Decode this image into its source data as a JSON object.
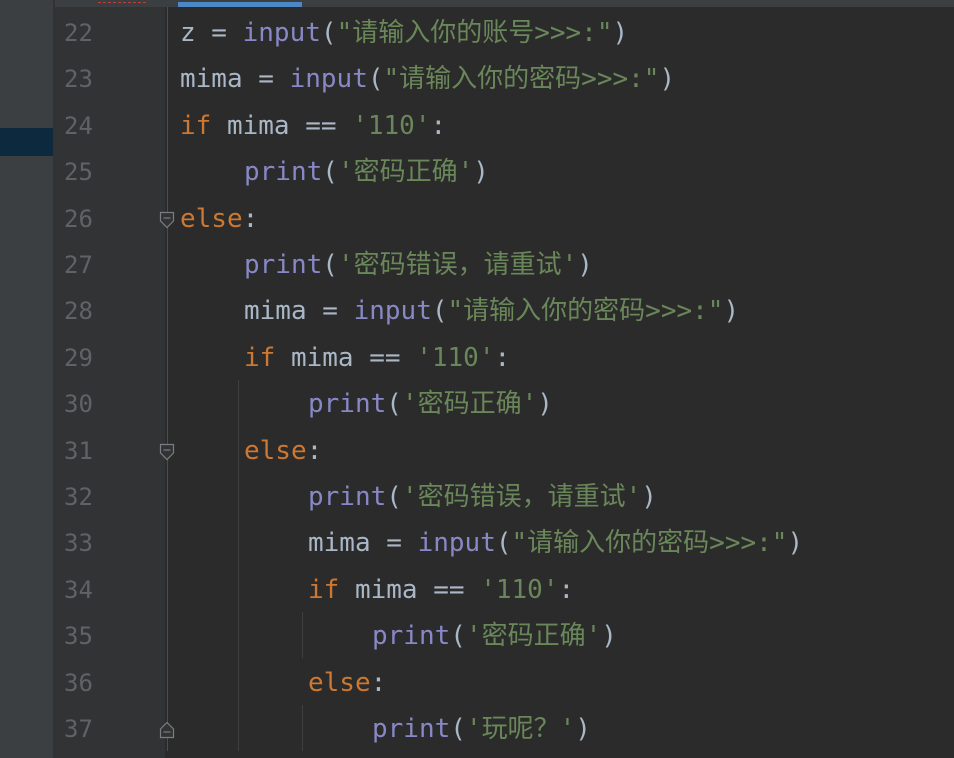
{
  "editor": {
    "lines": [
      {
        "num": "22",
        "indent": 0,
        "fold": "",
        "tokens": [
          {
            "t": "id",
            "v": "z = "
          },
          {
            "t": "fn",
            "v": "input"
          },
          {
            "t": "pn",
            "v": "("
          },
          {
            "t": "str",
            "v": "\"请输入你的账号>>>:\""
          },
          {
            "t": "pn",
            "v": ")"
          }
        ]
      },
      {
        "num": "23",
        "indent": 0,
        "fold": "",
        "tokens": [
          {
            "t": "id",
            "v": "mima = "
          },
          {
            "t": "fn",
            "v": "input"
          },
          {
            "t": "pn",
            "v": "("
          },
          {
            "t": "str",
            "v": "\"请输入你的密码>>>:\""
          },
          {
            "t": "pn",
            "v": ")"
          }
        ]
      },
      {
        "num": "24",
        "indent": 0,
        "fold": "",
        "tokens": [
          {
            "t": "kw",
            "v": "if "
          },
          {
            "t": "id",
            "v": "mima == "
          },
          {
            "t": "str",
            "v": "'110'"
          },
          {
            "t": "pn",
            "v": ":"
          }
        ]
      },
      {
        "num": "25",
        "indent": 1,
        "fold": "",
        "tokens": [
          {
            "t": "fn",
            "v": "print"
          },
          {
            "t": "pn",
            "v": "("
          },
          {
            "t": "str",
            "v": "'密码正确'"
          },
          {
            "t": "pn",
            "v": ")"
          }
        ]
      },
      {
        "num": "26",
        "indent": 0,
        "fold": "open",
        "tokens": [
          {
            "t": "kw",
            "v": "else"
          },
          {
            "t": "pn",
            "v": ":"
          }
        ]
      },
      {
        "num": "27",
        "indent": 1,
        "fold": "",
        "tokens": [
          {
            "t": "fn",
            "v": "print"
          },
          {
            "t": "pn",
            "v": "("
          },
          {
            "t": "str",
            "v": "'密码错误，请重试'"
          },
          {
            "t": "pn",
            "v": ")"
          }
        ]
      },
      {
        "num": "28",
        "indent": 1,
        "fold": "",
        "tokens": [
          {
            "t": "id",
            "v": "mima = "
          },
          {
            "t": "fn",
            "v": "input"
          },
          {
            "t": "pn",
            "v": "("
          },
          {
            "t": "str",
            "v": "\"请输入你的密码>>>:\""
          },
          {
            "t": "pn",
            "v": ")"
          }
        ]
      },
      {
        "num": "29",
        "indent": 1,
        "fold": "",
        "tokens": [
          {
            "t": "kw",
            "v": "if "
          },
          {
            "t": "id",
            "v": "mima == "
          },
          {
            "t": "str",
            "v": "'110'"
          },
          {
            "t": "pn",
            "v": ":"
          }
        ]
      },
      {
        "num": "30",
        "indent": 2,
        "fold": "",
        "tokens": [
          {
            "t": "fn",
            "v": "print"
          },
          {
            "t": "pn",
            "v": "("
          },
          {
            "t": "str",
            "v": "'密码正确'"
          },
          {
            "t": "pn",
            "v": ")"
          }
        ]
      },
      {
        "num": "31",
        "indent": 1,
        "fold": "open",
        "tokens": [
          {
            "t": "kw",
            "v": "else"
          },
          {
            "t": "pn",
            "v": ":"
          }
        ]
      },
      {
        "num": "32",
        "indent": 2,
        "fold": "",
        "tokens": [
          {
            "t": "fn",
            "v": "print"
          },
          {
            "t": "pn",
            "v": "("
          },
          {
            "t": "str",
            "v": "'密码错误，请重试'"
          },
          {
            "t": "pn",
            "v": ")"
          }
        ]
      },
      {
        "num": "33",
        "indent": 2,
        "fold": "",
        "tokens": [
          {
            "t": "id",
            "v": "mima = "
          },
          {
            "t": "fn",
            "v": "input"
          },
          {
            "t": "pn",
            "v": "("
          },
          {
            "t": "str",
            "v": "\"请输入你的密码>>>:\""
          },
          {
            "t": "pn",
            "v": ")"
          }
        ]
      },
      {
        "num": "34",
        "indent": 2,
        "fold": "",
        "tokens": [
          {
            "t": "kw",
            "v": "if "
          },
          {
            "t": "id",
            "v": "mima == "
          },
          {
            "t": "str",
            "v": "'110'"
          },
          {
            "t": "pn",
            "v": ":"
          }
        ]
      },
      {
        "num": "35",
        "indent": 3,
        "fold": "",
        "tokens": [
          {
            "t": "fn",
            "v": "print"
          },
          {
            "t": "pn",
            "v": "("
          },
          {
            "t": "str",
            "v": "'密码正确'"
          },
          {
            "t": "pn",
            "v": ")"
          }
        ]
      },
      {
        "num": "36",
        "indent": 2,
        "fold": "",
        "tokens": [
          {
            "t": "kw",
            "v": "else"
          },
          {
            "t": "pn",
            "v": ":"
          }
        ]
      },
      {
        "num": "37",
        "indent": 3,
        "fold": "close",
        "tokens": [
          {
            "t": "fn",
            "v": "print"
          },
          {
            "t": "pn",
            "v": "("
          },
          {
            "t": "str",
            "v": "'玩呢？'"
          },
          {
            "t": "pn",
            "v": ")"
          }
        ]
      }
    ]
  },
  "colors": {
    "keyword": "#cc7832",
    "builtin": "#8888c6",
    "string": "#6a8759",
    "text": "#a9b7c6",
    "line_number": "#606366",
    "background": "#2b2b2b",
    "gutter": "#313335",
    "selection_accent": "#4a88c7"
  }
}
